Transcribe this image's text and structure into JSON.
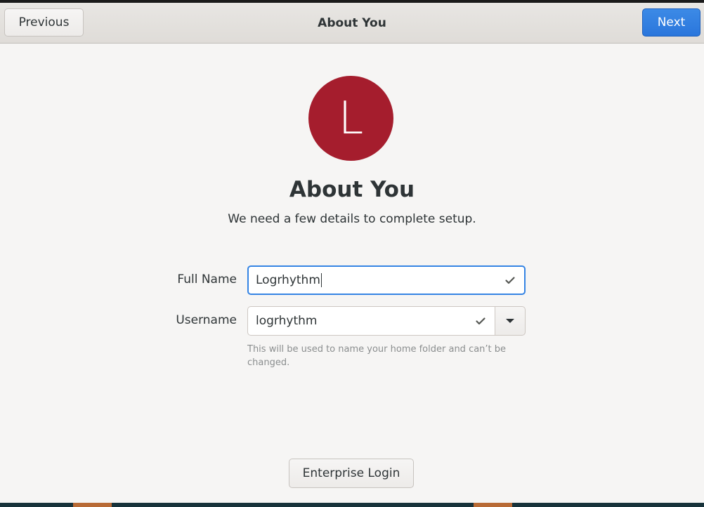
{
  "header": {
    "title": "About You",
    "previous_label": "Previous",
    "next_label": "Next"
  },
  "avatar": {
    "initial": "L",
    "color": "#a51d2d"
  },
  "main": {
    "title": "About You",
    "subtitle": "We need a few details to complete setup."
  },
  "form": {
    "full_name_label": "Full Name",
    "full_name_value": "Logrhythm",
    "full_name_status_icon": "check-icon",
    "username_label": "Username",
    "username_value": "logrhythm",
    "username_status_icon": "check-icon",
    "username_dropdown_icon": "triangle-down-icon",
    "username_hint": "This will be used to name your home folder and can’t be changed."
  },
  "footer": {
    "enterprise_login_label": "Enterprise Login"
  },
  "colors": {
    "accent": "#3584e4",
    "avatar": "#a51d2d",
    "background": "#f6f5f4",
    "text": "#2e3436"
  }
}
